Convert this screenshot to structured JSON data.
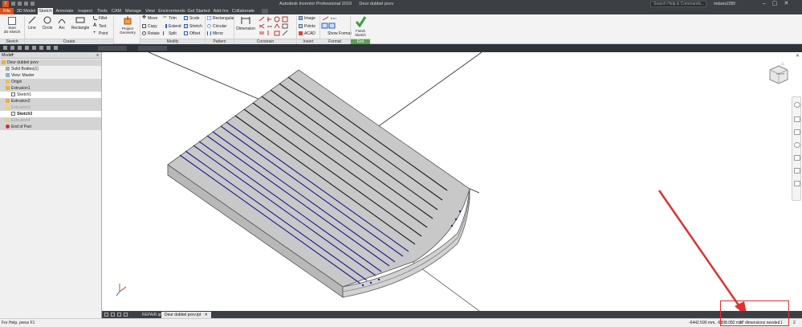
{
  "title_bar": {
    "app_title": "Autodesk Inventor Professional 2019",
    "document": "Deur dubbel pxvv",
    "search_placeholder": "Search Help & Commands...",
    "user": "mdavis2289"
  },
  "menu_tabs": [
    {
      "label": "File"
    },
    {
      "label": "3D Model"
    },
    {
      "label": "Sketch"
    },
    {
      "label": "Annotate"
    },
    {
      "label": "Inspect"
    },
    {
      "label": "Tools"
    },
    {
      "label": "CAM"
    },
    {
      "label": "Manage"
    },
    {
      "label": "View"
    },
    {
      "label": "Environments"
    },
    {
      "label": "Get Started"
    },
    {
      "label": "Add-Ins"
    },
    {
      "label": "Collaborate"
    }
  ],
  "ribbon": {
    "sketch_panel": {
      "start_2d": "Start\n2D Sketch",
      "label": "Sketch"
    },
    "create_panel": {
      "line": "Line",
      "circle": "Circle",
      "arc": "Arc",
      "rectangle": "Rectangle",
      "fillet": "Fillet",
      "text": "Text",
      "point": "Point",
      "label": "Create"
    },
    "project_panel": {
      "project_geometry": "Project Geometry"
    },
    "modify_panel": {
      "move": "Move",
      "copy": "Copy",
      "rotate": "Rotate",
      "trim": "Trim",
      "extend": "Extend",
      "split": "Split",
      "scale": "Scale",
      "stretch": "Stretch",
      "offset": "Offset",
      "label": "Modify"
    },
    "pattern_panel": {
      "rectangular": "Rectangular",
      "circular": "Circular",
      "mirror": "Mirror",
      "label": "Pattern"
    },
    "constrain_panel": {
      "dimension": "Dimension",
      "label": "Constrain"
    },
    "insert_panel": {
      "image": "Image",
      "points": "Points",
      "acad": "ACAD",
      "label": "Insert"
    },
    "format_panel": {
      "show_format": "Show Format",
      "label": "Format"
    },
    "exit_panel": {
      "finish_sketch": "Finish Sketch",
      "label": "Exit"
    }
  },
  "browser": {
    "header": "Model",
    "items": [
      {
        "label": "Deur dubbel pxvv"
      },
      {
        "label": "Solid Bodies(1)"
      },
      {
        "label": "View: Master"
      },
      {
        "label": "Origin"
      },
      {
        "label": "Extrusion1"
      },
      {
        "label": "Sketch1"
      },
      {
        "label": "Extrusion2"
      },
      {
        "label": "Extrusion3"
      },
      {
        "label": "Sketch3"
      },
      {
        "label": "Extrusion4"
      },
      {
        "label": "End of Part"
      }
    ]
  },
  "viewcube": {
    "label": "FRONT"
  },
  "doc_tabs": [
    {
      "label": "REPAIR.ipt"
    },
    {
      "label": "Deur dubbel pxvv.ipt"
    }
  ],
  "status_bar": {
    "help": "For Help, press F1",
    "coordinates": "-6442.590 mm, -6898.082 mm",
    "dimensions_needed": "17 dimensions needed",
    "count1": "1",
    "count2": "2"
  },
  "colors": {
    "accent_orange": "#d9531e",
    "dark_chrome": "#3c3f44",
    "sketch_blue": "#1a1a8c",
    "annotation_red": "#e03030"
  }
}
